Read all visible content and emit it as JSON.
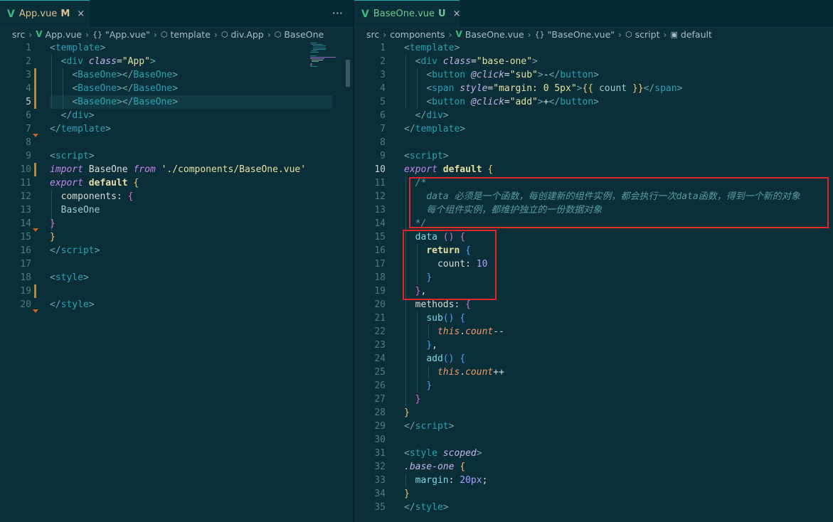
{
  "left_editor": {
    "tab": {
      "name": "App.vue",
      "badge": "M",
      "close": "×"
    },
    "more": "···",
    "breadcrumb": [
      "src",
      "App.vue",
      "\"App.vue\"",
      "template",
      "div.App",
      "BaseOne"
    ],
    "lines": [
      {
        "n": "1",
        "segs": [
          [
            "br",
            "<"
          ],
          [
            "tag",
            "template"
          ],
          [
            "br",
            ">"
          ]
        ]
      },
      {
        "n": "2",
        "segs": [
          [
            "pl",
            "  "
          ],
          [
            "br",
            "<"
          ],
          [
            "tag",
            "div "
          ],
          [
            "attr",
            "class"
          ],
          [
            "pl",
            "="
          ],
          [
            "str",
            "\"App\""
          ],
          [
            "br",
            ">"
          ]
        ]
      },
      {
        "n": "3",
        "segs": [
          [
            "pl",
            "    "
          ],
          [
            "br",
            "<"
          ],
          [
            "tag",
            "BaseOne"
          ],
          [
            "br",
            "></"
          ],
          [
            "tag",
            "BaseOne"
          ],
          [
            "br",
            ">"
          ]
        ]
      },
      {
        "n": "4",
        "segs": [
          [
            "pl",
            "    "
          ],
          [
            "br",
            "<"
          ],
          [
            "tag",
            "BaseOne"
          ],
          [
            "br",
            "></"
          ],
          [
            "tag",
            "BaseOne"
          ],
          [
            "br",
            ">"
          ]
        ]
      },
      {
        "n": "5",
        "segs": [
          [
            "pl",
            "    "
          ],
          [
            "br",
            "<"
          ],
          [
            "tag",
            "BaseOne"
          ],
          [
            "br",
            "></"
          ],
          [
            "tag",
            "BaseOne"
          ],
          [
            "br",
            ">"
          ]
        ]
      },
      {
        "n": "6",
        "segs": [
          [
            "pl",
            "  "
          ],
          [
            "br",
            "</"
          ],
          [
            "tag",
            "div"
          ],
          [
            "br",
            ">"
          ]
        ]
      },
      {
        "n": "7",
        "segs": [
          [
            "br",
            "</"
          ],
          [
            "tag",
            "template"
          ],
          [
            "br",
            ">"
          ]
        ]
      },
      {
        "n": "8",
        "segs": []
      },
      {
        "n": "9",
        "segs": [
          [
            "br",
            "<"
          ],
          [
            "tag",
            "script"
          ],
          [
            "br",
            ">"
          ]
        ]
      },
      {
        "n": "10",
        "segs": [
          [
            "kw",
            "import "
          ],
          [
            "pl",
            "BaseOne "
          ],
          [
            "kw",
            "from "
          ],
          [
            "str",
            "'./components/BaseOne.vue'"
          ]
        ]
      },
      {
        "n": "11",
        "segs": [
          [
            "kw",
            "export "
          ],
          [
            "kw2",
            "default "
          ],
          [
            "bp",
            "{"
          ]
        ]
      },
      {
        "n": "12",
        "segs": [
          [
            "pl",
            "  components: "
          ],
          [
            "bv",
            "{"
          ]
        ]
      },
      {
        "n": "13",
        "segs": [
          [
            "pl",
            "  "
          ],
          [
            "id",
            "BaseOne"
          ]
        ]
      },
      {
        "n": "14",
        "segs": [
          [
            "bv",
            "}"
          ]
        ]
      },
      {
        "n": "15",
        "segs": [
          [
            "bp",
            "}"
          ]
        ]
      },
      {
        "n": "16",
        "segs": [
          [
            "br",
            "</"
          ],
          [
            "tag",
            "script"
          ],
          [
            "br",
            ">"
          ]
        ]
      },
      {
        "n": "17",
        "segs": []
      },
      {
        "n": "18",
        "segs": [
          [
            "br",
            "<"
          ],
          [
            "tag",
            "style"
          ],
          [
            "br",
            ">"
          ]
        ]
      },
      {
        "n": "19",
        "segs": []
      },
      {
        "n": "20",
        "segs": [
          [
            "br",
            "</"
          ],
          [
            "tag",
            "style"
          ],
          [
            "br",
            ">"
          ]
        ]
      }
    ]
  },
  "right_editor": {
    "tab": {
      "name": "BaseOne.vue",
      "badge": "U",
      "close": "×"
    },
    "breadcrumb": [
      "src",
      "components",
      "BaseOne.vue",
      "\"BaseOne.vue\"",
      "script",
      "default"
    ],
    "lines": [
      {
        "n": "1",
        "segs": [
          [
            "br",
            "<"
          ],
          [
            "tag",
            "template"
          ],
          [
            "br",
            ">"
          ]
        ]
      },
      {
        "n": "2",
        "segs": [
          [
            "pl",
            "  "
          ],
          [
            "br",
            "<"
          ],
          [
            "tag",
            "div "
          ],
          [
            "attr",
            "class"
          ],
          [
            "pl",
            "="
          ],
          [
            "str",
            "\"base-one\""
          ],
          [
            "br",
            ">"
          ]
        ]
      },
      {
        "n": "3",
        "segs": [
          [
            "pl",
            "    "
          ],
          [
            "br",
            "<"
          ],
          [
            "tag",
            "button "
          ],
          [
            "attr",
            "@click"
          ],
          [
            "pl",
            "="
          ],
          [
            "str",
            "\"sub\""
          ],
          [
            "br",
            ">"
          ],
          [
            "pl",
            "-"
          ],
          [
            "br",
            "</"
          ],
          [
            "tag",
            "button"
          ],
          [
            "br",
            ">"
          ]
        ]
      },
      {
        "n": "4",
        "segs": [
          [
            "pl",
            "    "
          ],
          [
            "br",
            "<"
          ],
          [
            "tag",
            "span "
          ],
          [
            "attr",
            "style"
          ],
          [
            "pl",
            "="
          ],
          [
            "str",
            "\"margin: 0 5px\""
          ],
          [
            "br",
            ">"
          ],
          [
            "bp",
            "{{ "
          ],
          [
            "id",
            "count"
          ],
          [
            "bp",
            " }}"
          ],
          [
            "br",
            "</"
          ],
          [
            "tag",
            "span"
          ],
          [
            "br",
            ">"
          ]
        ]
      },
      {
        "n": "5",
        "segs": [
          [
            "pl",
            "    "
          ],
          [
            "br",
            "<"
          ],
          [
            "tag",
            "button "
          ],
          [
            "attr",
            "@click"
          ],
          [
            "pl",
            "="
          ],
          [
            "str",
            "\"add\""
          ],
          [
            "br",
            ">"
          ],
          [
            "pl",
            "+"
          ],
          [
            "br",
            "</"
          ],
          [
            "tag",
            "button"
          ],
          [
            "br",
            ">"
          ]
        ]
      },
      {
        "n": "6",
        "segs": [
          [
            "pl",
            "  "
          ],
          [
            "br",
            "</"
          ],
          [
            "tag",
            "div"
          ],
          [
            "br",
            ">"
          ]
        ]
      },
      {
        "n": "7",
        "segs": [
          [
            "br",
            "</"
          ],
          [
            "tag",
            "template"
          ],
          [
            "br",
            ">"
          ]
        ]
      },
      {
        "n": "8",
        "segs": []
      },
      {
        "n": "9",
        "segs": [
          [
            "br",
            "<"
          ],
          [
            "tag",
            "script"
          ],
          [
            "br",
            ">"
          ]
        ]
      },
      {
        "n": "10",
        "segs": [
          [
            "kw",
            "export "
          ],
          [
            "kw2",
            "default "
          ],
          [
            "bp",
            "{"
          ]
        ]
      },
      {
        "n": "11",
        "segs": [
          [
            "com",
            "  /*"
          ]
        ]
      },
      {
        "n": "12",
        "segs": [
          [
            "com",
            "    data 必须是一个函数，每创建新的组件实例，都会执行一次data函数，得到一个新的对象"
          ]
        ]
      },
      {
        "n": "13",
        "segs": [
          [
            "com",
            "    每个组件实例，都维护独立的一份数据对象"
          ]
        ]
      },
      {
        "n": "14",
        "segs": [
          [
            "com",
            "  */"
          ]
        ]
      },
      {
        "n": "15",
        "segs": [
          [
            "pl",
            "  "
          ],
          [
            "fn",
            "data "
          ],
          [
            "bv",
            "() {"
          ]
        ]
      },
      {
        "n": "16",
        "segs": [
          [
            "pl",
            "    "
          ],
          [
            "kw2",
            "return "
          ],
          [
            "bb",
            "{"
          ]
        ]
      },
      {
        "n": "17",
        "segs": [
          [
            "pl",
            "      count: "
          ],
          [
            "num",
            "10"
          ]
        ]
      },
      {
        "n": "18",
        "segs": [
          [
            "pl",
            "    "
          ],
          [
            "bb",
            "}"
          ]
        ]
      },
      {
        "n": "19",
        "segs": [
          [
            "pl",
            "  "
          ],
          [
            "bv",
            "}"
          ],
          [
            "pl",
            ","
          ]
        ]
      },
      {
        "n": "20",
        "segs": [
          [
            "pl",
            "  methods: "
          ],
          [
            "bv",
            "{"
          ]
        ]
      },
      {
        "n": "21",
        "segs": [
          [
            "pl",
            "    "
          ],
          [
            "fn",
            "sub"
          ],
          [
            "bb",
            "() {"
          ]
        ]
      },
      {
        "n": "22",
        "segs": [
          [
            "pl",
            "      "
          ],
          [
            "this",
            "this"
          ],
          [
            "pl",
            "."
          ],
          [
            "this",
            "count"
          ],
          [
            "pl",
            "--"
          ]
        ]
      },
      {
        "n": "23",
        "segs": [
          [
            "pl",
            "    "
          ],
          [
            "bb",
            "}"
          ],
          [
            "pl",
            ","
          ]
        ]
      },
      {
        "n": "24",
        "segs": [
          [
            "pl",
            "    "
          ],
          [
            "fn",
            "add"
          ],
          [
            "bb",
            "() {"
          ]
        ]
      },
      {
        "n": "25",
        "segs": [
          [
            "pl",
            "      "
          ],
          [
            "this",
            "this"
          ],
          [
            "pl",
            "."
          ],
          [
            "this",
            "count"
          ],
          [
            "pl",
            "++"
          ]
        ]
      },
      {
        "n": "26",
        "segs": [
          [
            "pl",
            "    "
          ],
          [
            "bb",
            "}"
          ]
        ]
      },
      {
        "n": "27",
        "segs": [
          [
            "pl",
            "  "
          ],
          [
            "bv",
            "}"
          ]
        ]
      },
      {
        "n": "28",
        "segs": [
          [
            "bp",
            "}"
          ]
        ]
      },
      {
        "n": "29",
        "segs": [
          [
            "br",
            "</"
          ],
          [
            "tag",
            "script"
          ],
          [
            "br",
            ">"
          ]
        ]
      },
      {
        "n": "30",
        "segs": []
      },
      {
        "n": "31",
        "segs": [
          [
            "br",
            "<"
          ],
          [
            "tag",
            "style "
          ],
          [
            "attr",
            "scoped"
          ],
          [
            "br",
            ">"
          ]
        ]
      },
      {
        "n": "32",
        "segs": [
          [
            "attr",
            ".base-one "
          ],
          [
            "bp",
            "{"
          ]
        ]
      },
      {
        "n": "33",
        "segs": [
          [
            "pl",
            "  "
          ],
          [
            "prop",
            "margin"
          ],
          [
            "pl",
            ": "
          ],
          [
            "num",
            "20px"
          ],
          [
            "pl",
            ";"
          ]
        ]
      },
      {
        "n": "34",
        "segs": [
          [
            "bp",
            "}"
          ]
        ]
      },
      {
        "n": "35",
        "segs": [
          [
            "br",
            "</"
          ],
          [
            "tag",
            "style"
          ],
          [
            "br",
            ">"
          ]
        ]
      }
    ]
  },
  "colors": {
    "accent": "#2aa1b3",
    "vue": "#41b883",
    "modified": "#e2c08d",
    "highlight_box": "#e0262b"
  },
  "icons": [
    "vue-icon",
    "braces-icon",
    "cube-icon",
    "chevron-right-icon",
    "close-icon",
    "more-icon"
  ]
}
